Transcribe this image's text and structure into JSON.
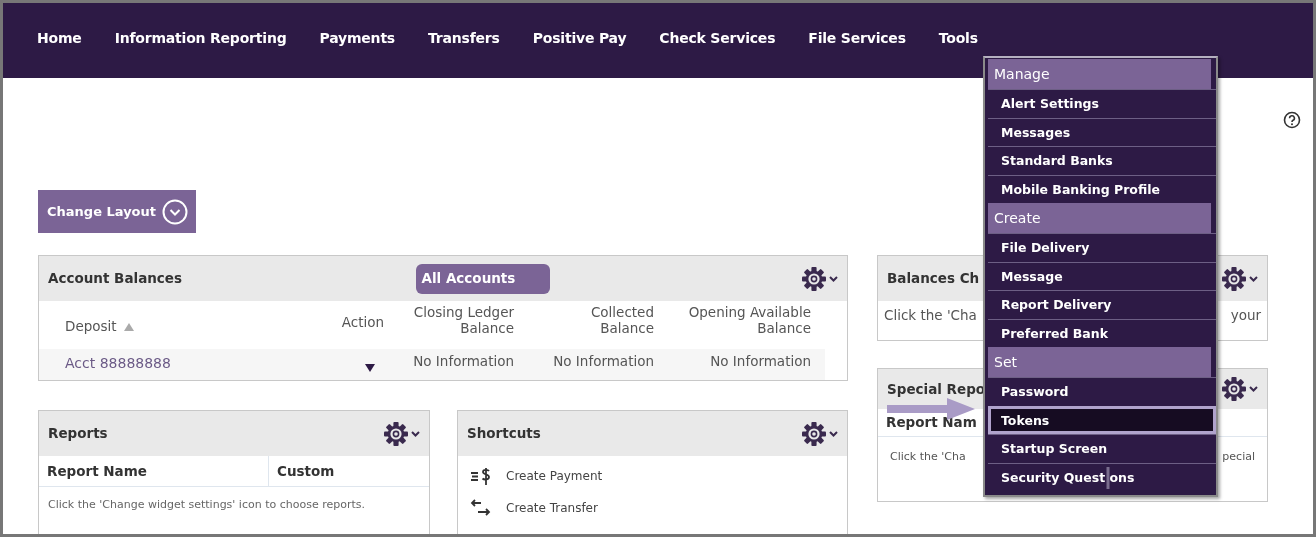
{
  "nav": [
    "Home",
    "Information Reporting",
    "Payments",
    "Transfers",
    "Positive Pay",
    "Check Services",
    "File Services",
    "Tools"
  ],
  "tools_menu": {
    "sections": [
      {
        "heading": "Manage",
        "items": [
          {
            "label": "Alert Settings",
            "selected": false
          },
          {
            "label": "Messages",
            "selected": false
          },
          {
            "label": "Standard Banks",
            "selected": false
          },
          {
            "label": "Mobile Banking Profile",
            "selected": false
          }
        ]
      },
      {
        "heading": "Create",
        "items": [
          {
            "label": "File Delivery",
            "selected": false
          },
          {
            "label": "Message",
            "selected": false
          },
          {
            "label": "Report Delivery",
            "selected": false
          },
          {
            "label": "Preferred Bank",
            "selected": false
          }
        ]
      },
      {
        "heading": "Set",
        "items": [
          {
            "label": "Password",
            "selected": false
          },
          {
            "label": "Tokens",
            "selected": true
          },
          {
            "label": "Startup Screen",
            "selected": false
          },
          {
            "label": "Security Quest ons",
            "selected": false
          }
        ]
      }
    ]
  },
  "change_layout_button": "Change Layout",
  "account_balances": {
    "title": "Account Balances",
    "filter_button": "All Accounts",
    "columns": [
      {
        "label": "Deposit",
        "sorted": true
      },
      {
        "label": "Action",
        "sorted": false
      },
      {
        "label": "Closing Ledger Balance",
        "sorted": false
      },
      {
        "label": "Collected Balance",
        "sorted": false
      },
      {
        "label": "Opening Available Balance",
        "sorted": false
      }
    ],
    "rows": [
      {
        "cells": [
          {
            "kind": "link",
            "text": "Acct 88888888"
          },
          {
            "kind": "menu"
          },
          {
            "kind": "text",
            "text": "No Information"
          },
          {
            "kind": "text",
            "text": "No Information"
          },
          {
            "kind": "text",
            "text": "No Information"
          }
        ]
      }
    ]
  },
  "reports": {
    "title": "Reports",
    "columns": [
      "Report Name",
      "Custom"
    ],
    "empty_message": "Click the 'Change widget settings' icon to choose reports."
  },
  "shortcuts": {
    "title": "Shortcuts",
    "items": [
      {
        "label": "Create Payment",
        "kind": "payment"
      },
      {
        "label": "Create Transfer",
        "kind": "transfer"
      }
    ]
  },
  "balances_chart": {
    "title": "Balances Ch",
    "message_start": "Click the 'Cha",
    "message_end": "your"
  },
  "special_reports": {
    "title": "Special Repo",
    "column": "Report Nam",
    "message_start": "Click the 'Cha",
    "message_end": "pecial"
  }
}
